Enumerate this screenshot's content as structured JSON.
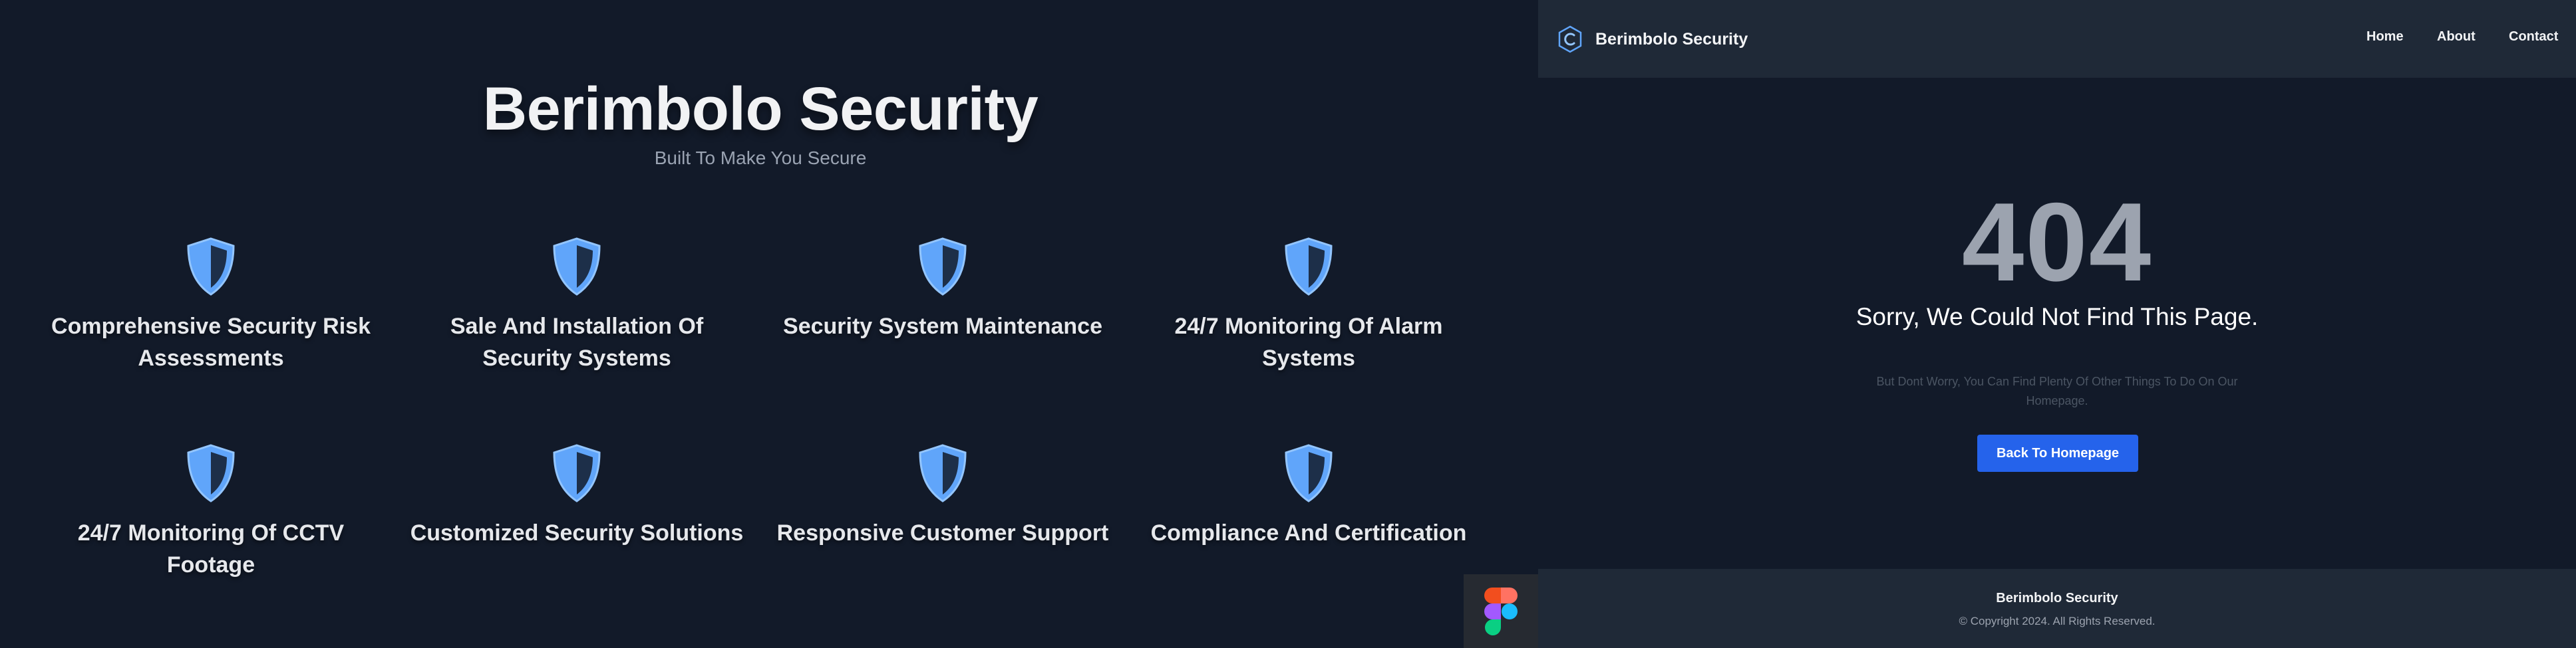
{
  "left": {
    "title": "Berimbolo Security",
    "subtitle": "Built To Make You Secure",
    "features": [
      {
        "label": "Comprehensive Security Risk Assessments",
        "icon": "shield-icon"
      },
      {
        "label": "Sale And Installation Of Security Systems",
        "icon": "shield-icon"
      },
      {
        "label": "Security System Maintenance",
        "icon": "shield-icon"
      },
      {
        "label": "24/7 Monitoring Of Alarm Systems",
        "icon": "shield-icon"
      },
      {
        "label": "24/7 Monitoring Of CCTV Footage",
        "icon": "shield-icon"
      },
      {
        "label": "Customized Security Solutions",
        "icon": "shield-icon"
      },
      {
        "label": "Responsive Customer Support",
        "icon": "shield-icon"
      },
      {
        "label": "Compliance And Certification",
        "icon": "shield-icon"
      }
    ],
    "badge_icon": "figma-icon"
  },
  "right": {
    "nav": {
      "brand": "Berimbolo Security",
      "brand_icon": "hexagon-c-logo-icon",
      "links": [
        "Home",
        "About",
        "Contact"
      ]
    },
    "error": {
      "code": "404",
      "title": "Sorry, We Could Not Find This Page.",
      "description": "But Dont Worry, You Can Find Plenty Of Other Things To Do On Our Homepage.",
      "button": "Back To Homepage"
    },
    "footer": {
      "brand": "Berimbolo Security",
      "copyright": "© Copyright 2024. All Rights Reserved."
    }
  },
  "colors": {
    "background": "#121a29",
    "panel": "#1f2937",
    "accent": "#2563eb",
    "shield": "#60a5fa"
  }
}
